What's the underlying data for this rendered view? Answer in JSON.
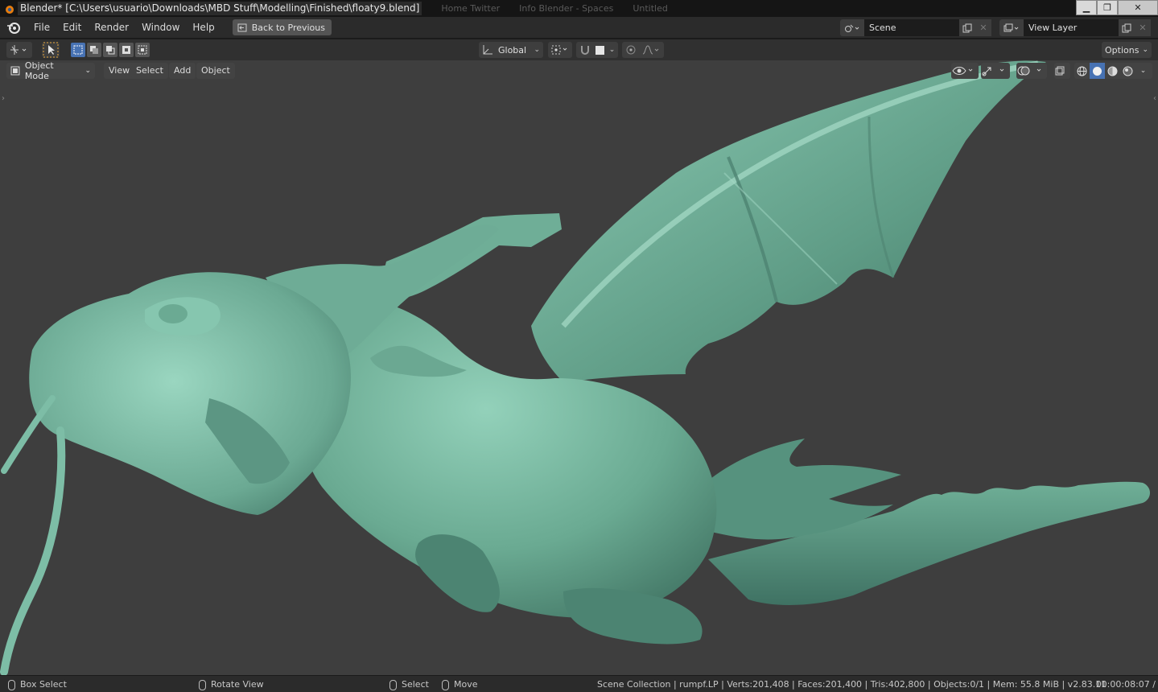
{
  "window": {
    "title": "Blender* [C:\\Users\\usuario\\Downloads\\MBD Stuff\\Modelling\\Finished\\floaty9.blend]",
    "ghost_tabs": [
      "Home Twitter",
      "Info Blender - Spaces",
      "Untitled"
    ],
    "controls": {
      "minimize": "▁",
      "maximize": "❐",
      "close": "✕"
    }
  },
  "menubar": {
    "items": [
      "File",
      "Edit",
      "Render",
      "Window",
      "Help"
    ],
    "back_button": "Back to Previous",
    "scene_name": "Scene",
    "view_layer_name": "View Layer"
  },
  "toolheader": {
    "transform_orientation": "Global",
    "options_label": "Options"
  },
  "viewport": {
    "mode": "Object Mode",
    "menus": [
      "View",
      "Select",
      "Add",
      "Object"
    ],
    "model_color": "#7cb8a2",
    "background_color": "#3e3e3e"
  },
  "statusbar": {
    "box_select": "Box Select",
    "rotate_view": "Rotate View",
    "select": "Select",
    "move": "Move",
    "stats": "Scene Collection | rumpf.LP | Verts:201,408 | Faces:201,400 | Tris:402,800 | Objects:0/1 | Mem: 55.8 MiB | v2.83.11",
    "time": "00:00:08:07 /"
  }
}
